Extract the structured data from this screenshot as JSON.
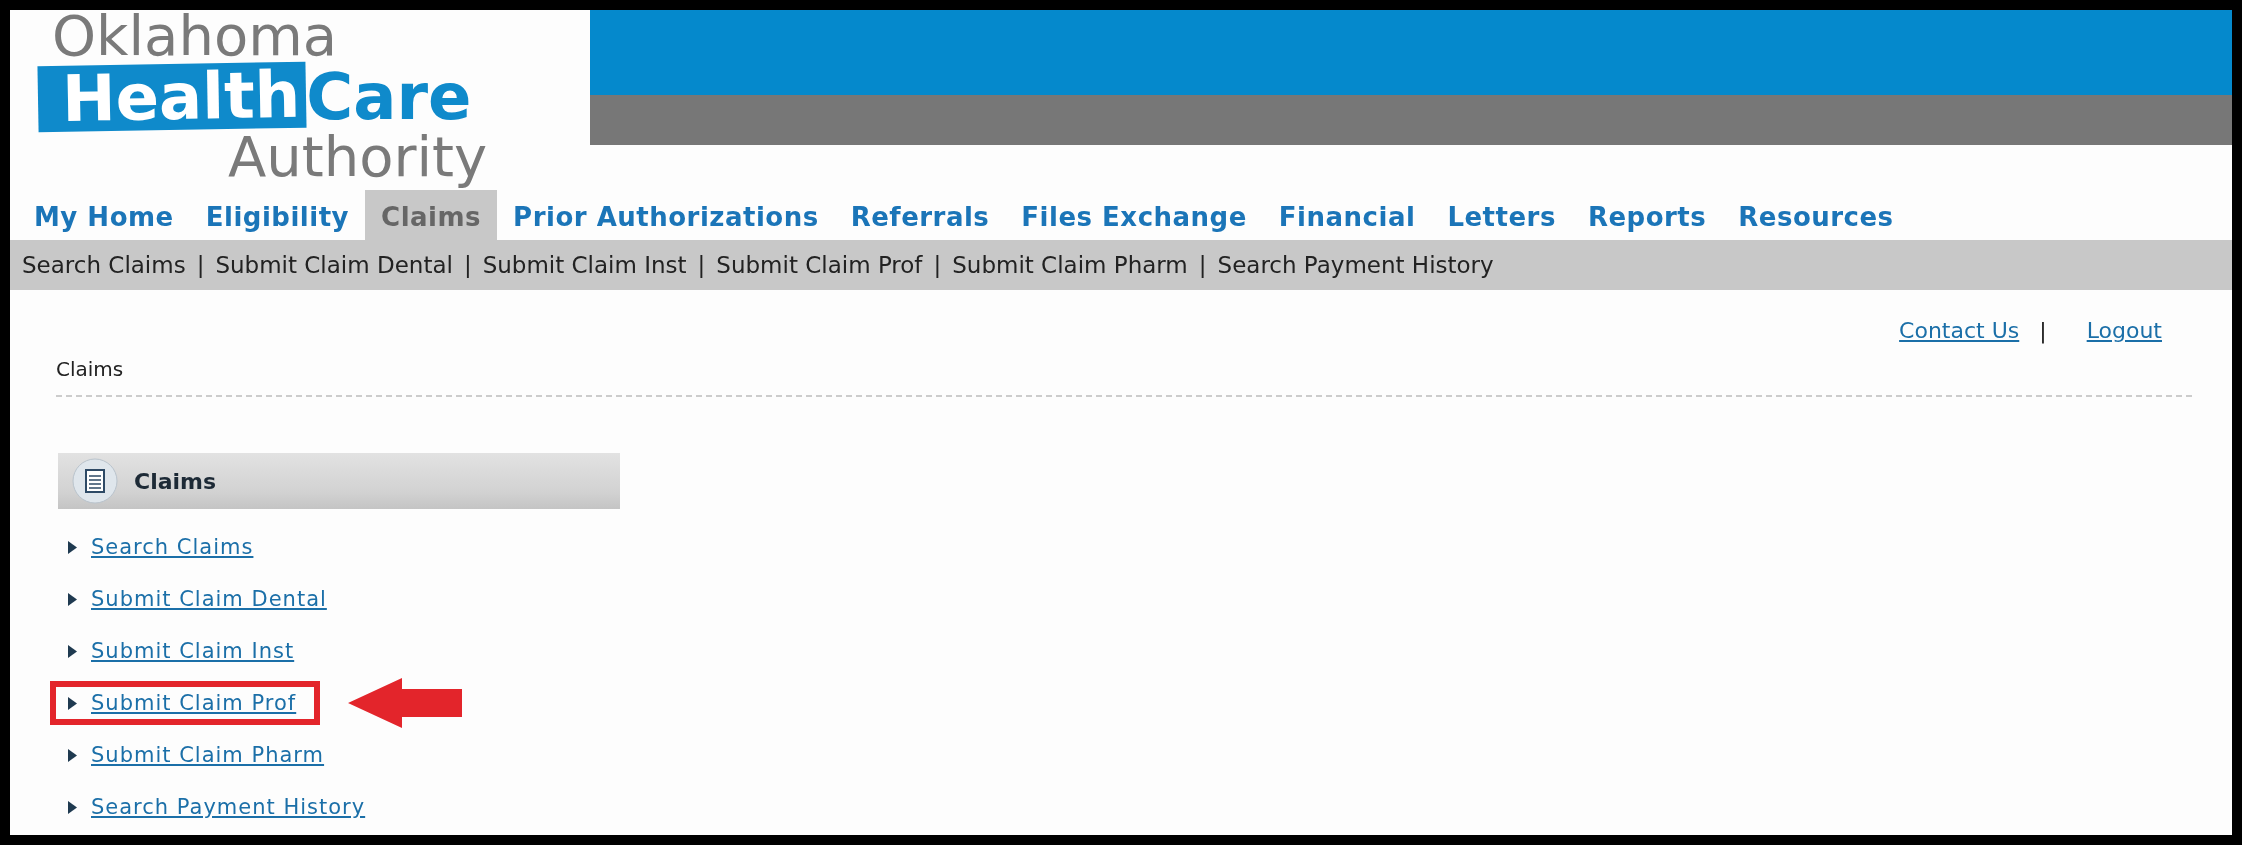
{
  "logo": {
    "line_1": "Oklahoma",
    "highlight": "Health",
    "line_2_rest": "Care",
    "line_3": "Authority"
  },
  "tabs": [
    {
      "label": "My Home",
      "selected": false
    },
    {
      "label": "Eligibility",
      "selected": false
    },
    {
      "label": "Claims",
      "selected": true
    },
    {
      "label": "Prior Authorizations",
      "selected": false
    },
    {
      "label": "Referrals",
      "selected": false
    },
    {
      "label": "Files Exchange",
      "selected": false
    },
    {
      "label": "Financial",
      "selected": false
    },
    {
      "label": "Letters",
      "selected": false
    },
    {
      "label": "Reports",
      "selected": false
    },
    {
      "label": "Resources",
      "selected": false
    }
  ],
  "subnav": {
    "separator": "|",
    "items": [
      "Search Claims",
      "Submit Claim Dental",
      "Submit Claim Inst",
      "Submit Claim Prof",
      "Submit Claim Pharm",
      "Search Payment History"
    ]
  },
  "header_links": {
    "separator": "|",
    "items": [
      "Contact Us",
      "Logout"
    ]
  },
  "breadcrumb": "Claims",
  "panel": {
    "title": "Claims",
    "links": [
      {
        "label": "Search Claims",
        "highlighted": false
      },
      {
        "label": "Submit Claim Dental",
        "highlighted": false
      },
      {
        "label": "Submit Claim Inst",
        "highlighted": false
      },
      {
        "label": "Submit Claim Prof",
        "highlighted": true
      },
      {
        "label": "Submit Claim Pharm",
        "highlighted": false
      },
      {
        "label": "Search Payment History",
        "highlighted": false
      }
    ]
  }
}
